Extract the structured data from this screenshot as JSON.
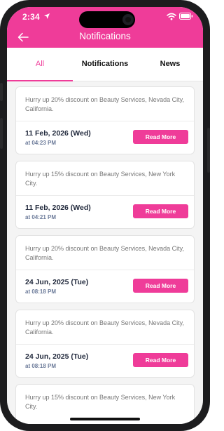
{
  "status_bar": {
    "time": "2:34"
  },
  "header": {
    "title": "Notifications"
  },
  "tabs": [
    {
      "label": "All"
    },
    {
      "label": "Notifications"
    },
    {
      "label": "News"
    }
  ],
  "notifications": [
    {
      "message": "Hurry up 20% discount on Beauty Services, Nevada City, California.",
      "date": "11 Feb, 2026 (Wed)",
      "time": "at 04:23 PM",
      "button": "Read More"
    },
    {
      "message": "Hurry up 15% discount on Beauty Services, New York City.",
      "date": "11 Feb, 2026 (Wed)",
      "time": "at 04:21 PM",
      "button": "Read More"
    },
    {
      "message": "Hurry up 20% discount on Beauty Services, Nevada City, California.",
      "date": "24 Jun, 2025 (Tue)",
      "time": "at 08:18 PM",
      "button": "Read More"
    },
    {
      "message": "Hurry up 20% discount on Beauty Services, Nevada City, California.",
      "date": "24 Jun, 2025 (Tue)",
      "time": "at 08:18 PM",
      "button": "Read More"
    },
    {
      "message": "Hurry up 15% discount on Beauty Services, New York City."
    }
  ],
  "colors": {
    "accent": "#ef3c99",
    "date_text": "#222a3d",
    "time_text": "#6b7a99"
  }
}
